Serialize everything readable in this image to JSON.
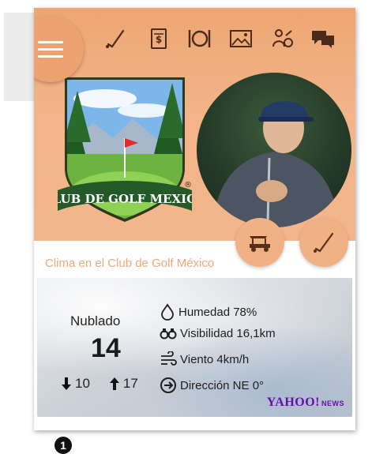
{
  "nav": {
    "menu_icon": "hamburger-icon",
    "icons": [
      "golf-club-icon",
      "scorecard-icon",
      "restaurant-icon",
      "gallery-icon",
      "events-icon",
      "chat-icon"
    ]
  },
  "club": {
    "logo_text": "CLUB DE GOLF MEXICO",
    "registered": "®"
  },
  "actions": {
    "cart_icon": "golf-cart-icon",
    "club_icon": "golf-club-icon"
  },
  "weather": {
    "title": "Clima en el Club de Golf México",
    "condition": "Nublado",
    "temperature": "14",
    "low": "10",
    "high": "17",
    "humidity": "Humedad 78%",
    "visibility": "Visibilidad 16,1km",
    "wind": "Viento 4km/h",
    "direction": "Dirección NE 0°",
    "source": "YAHOO!",
    "source_sub": "NEWS"
  },
  "footnote": "1",
  "colors": {
    "accent": "#eea271",
    "hero_bg": "#f2b488",
    "title_text": "#efa779"
  }
}
